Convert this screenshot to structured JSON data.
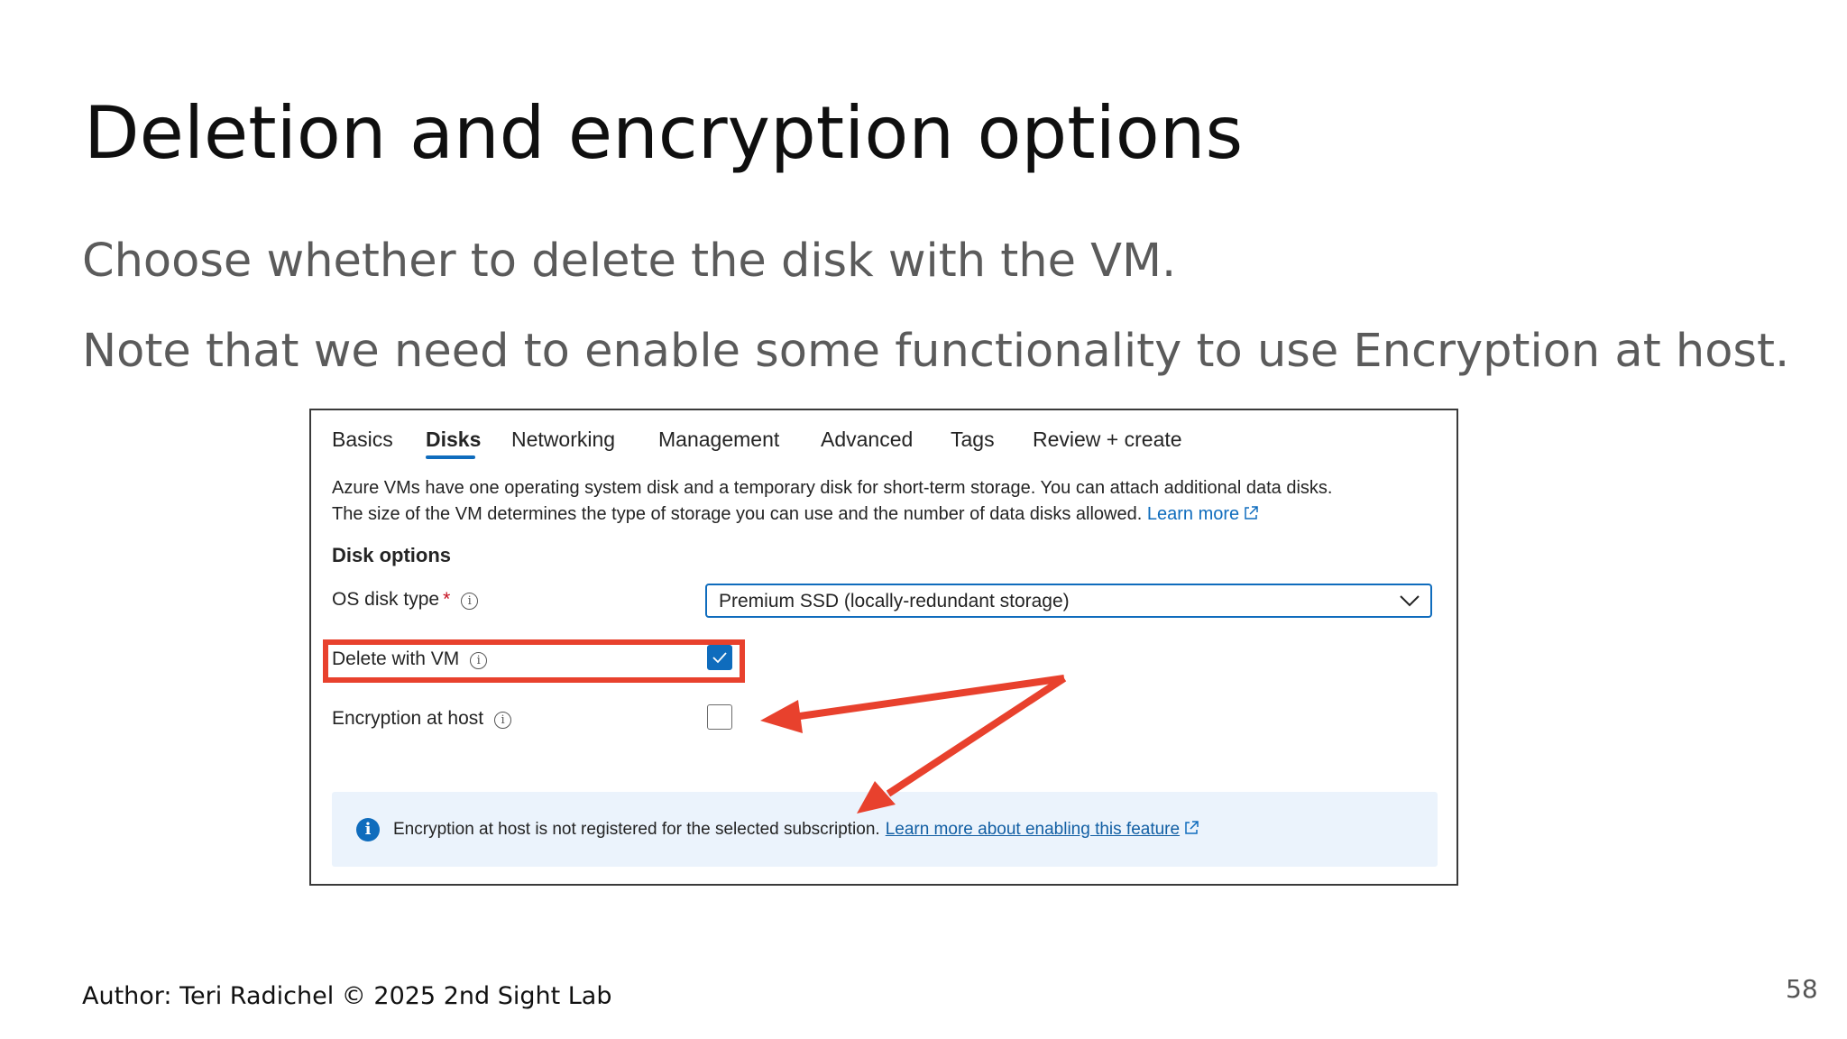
{
  "slide": {
    "title": "Deletion and encryption options",
    "bullets": [
      "Choose whether to delete the disk with the VM.",
      "Note that we need to enable some functionality to use Encryption at host."
    ],
    "footer": "Author: Teri Radichel © 2025 2nd Sight Lab",
    "page_number": "58"
  },
  "screenshot": {
    "tabs": [
      {
        "label": "Basics",
        "active": false
      },
      {
        "label": "Disks",
        "active": true
      },
      {
        "label": "Networking",
        "active": false
      },
      {
        "label": "Management",
        "active": false
      },
      {
        "label": "Advanced",
        "active": false
      },
      {
        "label": "Tags",
        "active": false
      },
      {
        "label": "Review + create",
        "active": false
      }
    ],
    "description_line1": "Azure VMs have one operating system disk and a temporary disk for short-term storage. You can attach additional data disks.",
    "description_line2": "The size of the VM determines the type of storage you can use and the number of data disks allowed.",
    "learn_more": "Learn more",
    "section_title": "Disk options",
    "os_disk_type": {
      "label": "OS disk type",
      "required_marker": "*",
      "value": "Premium SSD (locally-redundant storage)"
    },
    "delete_with_vm": {
      "label": "Delete with VM",
      "checked": true
    },
    "encryption_at_host": {
      "label": "Encryption at host",
      "checked": false
    },
    "info_bar": {
      "text": "Encryption at host is not registered for the selected subscription.",
      "link": "Learn more about enabling this feature"
    },
    "icons": {
      "info": "info-circle-icon",
      "external_link": "external-link-icon",
      "chevron": "chevron-down-icon",
      "checkmark": "checkmark-icon"
    },
    "colors": {
      "accent": "#0f6cbd",
      "annotation": "#e8412d",
      "info_bar_bg": "#ebf3fc"
    }
  }
}
